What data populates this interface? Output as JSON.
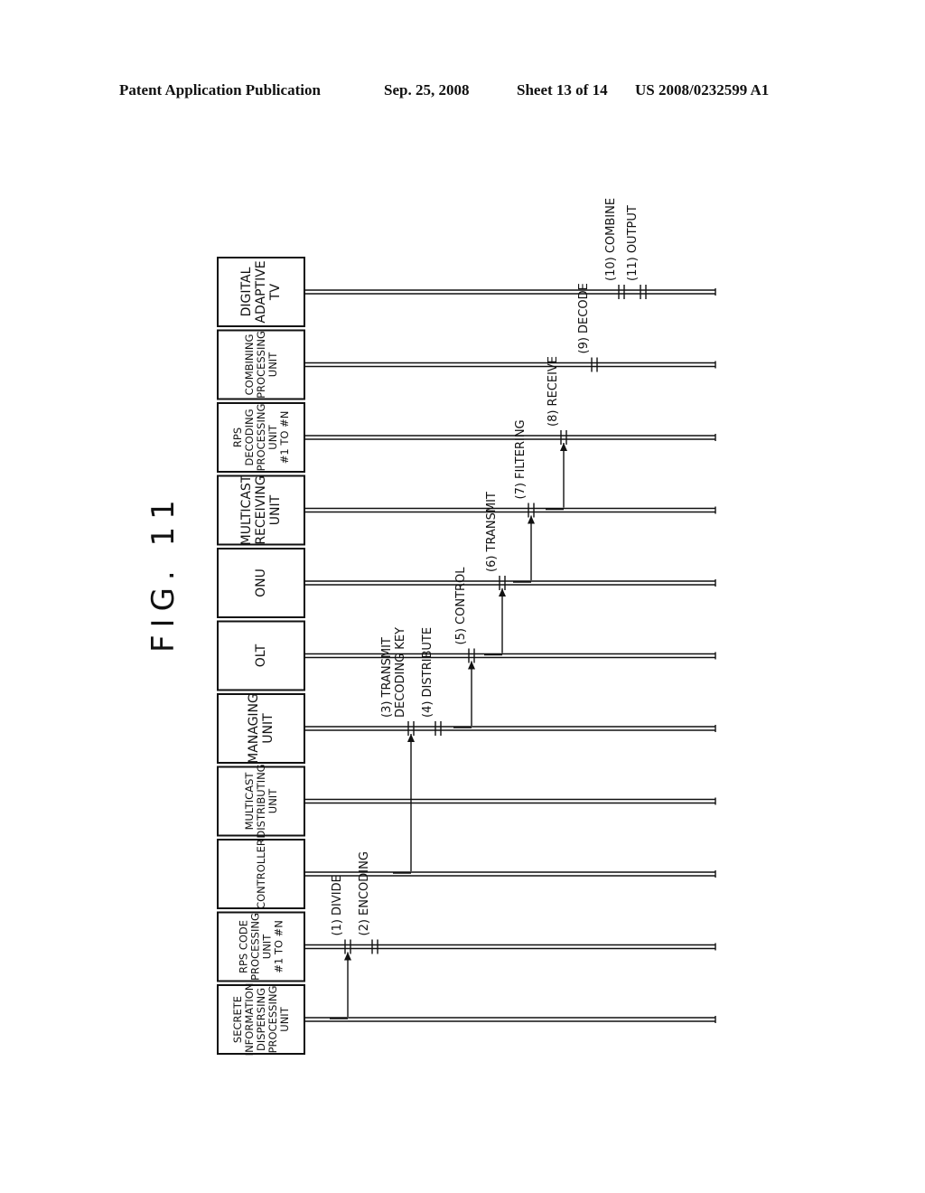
{
  "header": {
    "publication": "Patent Application Publication",
    "date": "Sep. 25, 2008",
    "sheet": "Sheet 13 of 14",
    "number": "US 2008/0232599 A1"
  },
  "figure": {
    "title": "FIG. 11",
    "orientation": "rotated 90 degrees counter-clockwise",
    "participants": [
      {
        "id": "sidp",
        "lines": [
          "SECRETE",
          "INFORMATION",
          "DISPERSING",
          "PROCESSING",
          "UNIT"
        ]
      },
      {
        "id": "rpsc",
        "lines": [
          "RPS CODE",
          "PROCESSING",
          "UNIT",
          "#1 TO #N"
        ]
      },
      {
        "id": "ctrl",
        "lines": [
          "CONTROLLER"
        ]
      },
      {
        "id": "mcd",
        "lines": [
          "MULTICAST",
          "DISTRIBUTING",
          "UNIT"
        ]
      },
      {
        "id": "mgr",
        "lines": [
          "MANAGING",
          "UNIT"
        ]
      },
      {
        "id": "olt",
        "lines": [
          "OLT"
        ]
      },
      {
        "id": "onu",
        "lines": [
          "ONU"
        ]
      },
      {
        "id": "mcr",
        "lines": [
          "MULTICAST",
          "RECEIVING",
          "UNIT"
        ]
      },
      {
        "id": "rpsd",
        "lines": [
          "RPS",
          "DECODING",
          "PROCESSING",
          "UNIT",
          "#1 TO #N"
        ]
      },
      {
        "id": "comb",
        "lines": [
          "COMBINING",
          "PROCESSING",
          "UNIT"
        ]
      },
      {
        "id": "datv",
        "lines": [
          "DIGITAL",
          "ADAPTIVE",
          "TV"
        ]
      }
    ],
    "messages": [
      {
        "step": 1,
        "label": [
          "(1) DIVIDE"
        ],
        "from": 0,
        "to": 1,
        "type": "arrow"
      },
      {
        "step": 2,
        "label": [
          "(2) ENCODING"
        ],
        "from": 1,
        "to": 1,
        "type": "process"
      },
      {
        "step": 3,
        "label": [
          "(3) TRANSMIT",
          "DECODING KEY"
        ],
        "from": 2,
        "to": 4,
        "type": "arrow"
      },
      {
        "step": 4,
        "label": [
          "(4) DISTRIBUTE"
        ],
        "from": 4,
        "to": 4,
        "type": "process"
      },
      {
        "step": 5,
        "label": [
          "(5) CONTROL"
        ],
        "from": 4,
        "to": 5,
        "type": "arrow"
      },
      {
        "step": 6,
        "label": [
          "(6) TRANSMIT"
        ],
        "from": 5,
        "to": 6,
        "type": "arrow"
      },
      {
        "step": 7,
        "label": [
          "(7) FILTERING"
        ],
        "from": 6,
        "to": 7,
        "type": "arrow"
      },
      {
        "step": 8,
        "label": [
          "(8) RECEIVE"
        ],
        "from": 7,
        "to": 8,
        "type": "arrow"
      },
      {
        "step": 9,
        "label": [
          "(9) DECODE"
        ],
        "from": 8,
        "to": 9,
        "type": "process"
      },
      {
        "step": 10,
        "label": [
          "(10) COMBINE"
        ],
        "from": 9,
        "to": 10,
        "type": "process"
      },
      {
        "step": 11,
        "label": [
          "(11) OUTPUT"
        ],
        "from": 10,
        "to": 10,
        "type": "process"
      }
    ]
  }
}
